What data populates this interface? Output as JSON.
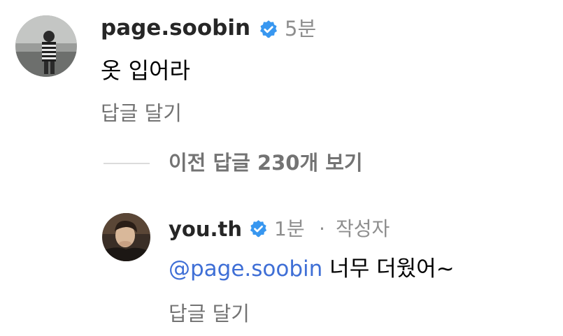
{
  "comment": {
    "username": "page.soobin",
    "time": "5분",
    "text": "옷 입어라",
    "reply_label": "답글 달기"
  },
  "view_replies": {
    "label": "이전 답글 230개 보기"
  },
  "reply": {
    "username": "you.th",
    "time": "1분",
    "separator": "·",
    "author_tag": "작성자",
    "mention": "@page.soobin",
    "text": "너무 더웠어~",
    "reply_label": "답글 달기"
  },
  "colors": {
    "verified_blue": "#3897f0",
    "mention_blue": "#3f6fd6",
    "meta_gray": "#8e8e8e"
  },
  "icons": {
    "verified": "verified-badge-icon"
  }
}
